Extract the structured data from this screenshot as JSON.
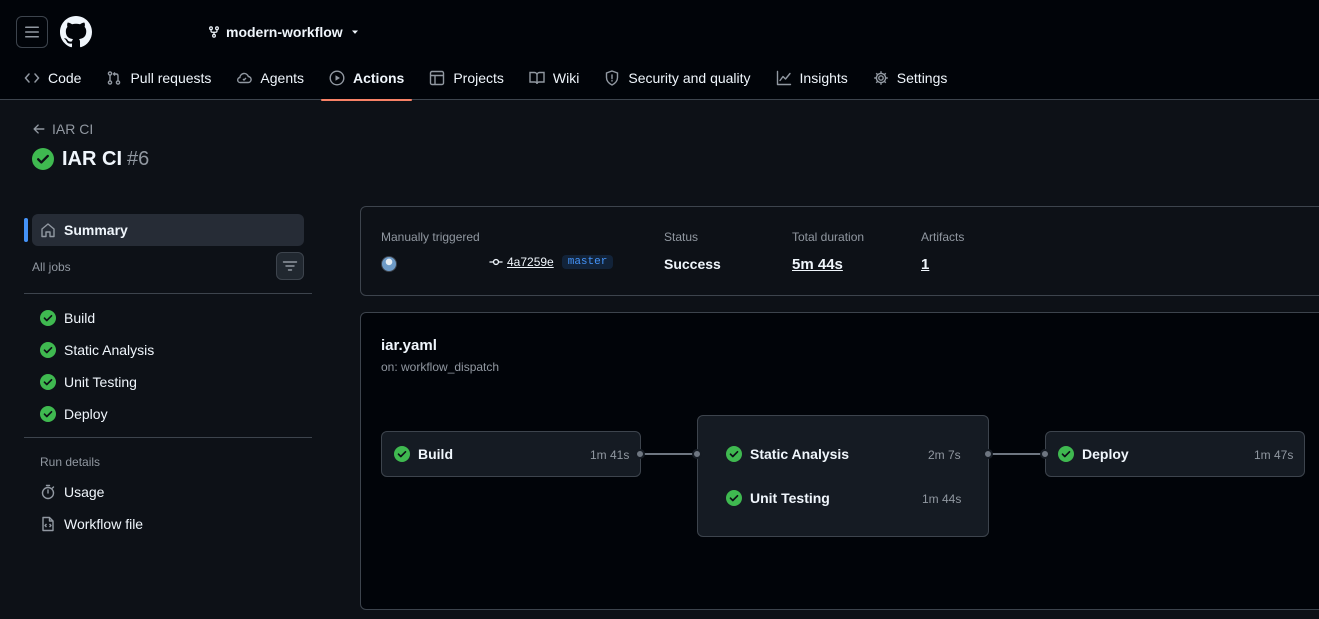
{
  "repo": {
    "name": "modern-workflow"
  },
  "nav": [
    {
      "label": "Code",
      "icon": "code-icon"
    },
    {
      "label": "Pull requests",
      "icon": "pull-request-icon"
    },
    {
      "label": "Agents",
      "icon": "agents-icon"
    },
    {
      "label": "Actions",
      "icon": "play-icon",
      "active": true
    },
    {
      "label": "Projects",
      "icon": "table-icon"
    },
    {
      "label": "Wiki",
      "icon": "book-icon"
    },
    {
      "label": "Security and quality",
      "icon": "shield-icon"
    },
    {
      "label": "Insights",
      "icon": "graph-icon"
    },
    {
      "label": "Settings",
      "icon": "gear-icon"
    }
  ],
  "back": {
    "label": "IAR CI"
  },
  "run": {
    "title": "IAR CI",
    "number": "#6"
  },
  "sidebar": {
    "summary_label": "Summary",
    "all_jobs_label": "All jobs",
    "jobs": [
      "Build",
      "Static Analysis",
      "Unit Testing",
      "Deploy"
    ],
    "run_details_label": "Run details",
    "details": [
      "Usage",
      "Workflow file"
    ]
  },
  "summary": {
    "trigger_label": "Manually triggered",
    "commit_sha": "4a7259e",
    "branch": "master",
    "status_label": "Status",
    "status_value": "Success",
    "duration_label": "Total duration",
    "duration_value": "5m 44s",
    "artifacts_label": "Artifacts",
    "artifacts_value": "1"
  },
  "workflow": {
    "file": "iar.yaml",
    "trigger": "on: workflow_dispatch",
    "build": {
      "name": "Build",
      "time": "1m 41s"
    },
    "static_analysis": {
      "name": "Static Analysis",
      "time": "2m 7s"
    },
    "unit_testing": {
      "name": "Unit Testing",
      "time": "1m 44s"
    },
    "deploy": {
      "name": "Deploy",
      "time": "1m 47s"
    }
  },
  "colors": {
    "success": "#3fb950",
    "accent": "#f78166",
    "link": "#4493f8"
  }
}
